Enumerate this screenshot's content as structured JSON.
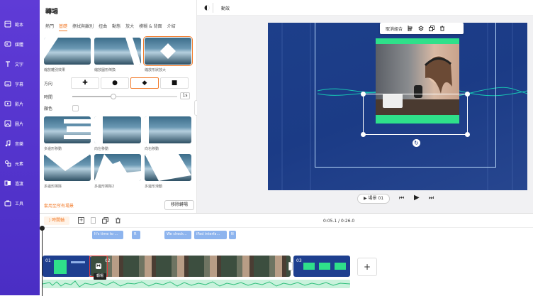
{
  "sidebar": {
    "items": [
      {
        "label": "範本",
        "icon": "template-icon"
      },
      {
        "label": "媒體",
        "icon": "media-icon"
      },
      {
        "label": "文字",
        "icon": "text-icon"
      },
      {
        "label": "字幕",
        "icon": "subtitle-icon"
      },
      {
        "label": "影片",
        "icon": "video-icon"
      },
      {
        "label": "圖片",
        "icon": "image-icon"
      },
      {
        "label": "音樂",
        "icon": "music-icon"
      },
      {
        "label": "元素",
        "icon": "element-icon"
      },
      {
        "label": "過渡",
        "icon": "transition-icon"
      },
      {
        "label": "工具",
        "icon": "tools-icon"
      }
    ]
  },
  "panel": {
    "title": "轉場",
    "tabs": [
      "熱門",
      "基礎",
      "擦拭與離別",
      "扭曲",
      "動態",
      "放大",
      "模糊 & 背面",
      "介紹"
    ],
    "active_tab": 1,
    "thumbs_row1": [
      "縮放離別效果",
      "縮放圖形倒換",
      "縮放形狀放大"
    ],
    "direction_label": "方向",
    "duration_label": "時間",
    "duration_value": "1s",
    "color_label": "顏色",
    "thumbs_row2": [
      "多邊形移動",
      "向左移動",
      "向右移動"
    ],
    "thumbs_row3": [
      "多邊形擦除",
      "多邊形擦除2",
      "多邊形滑動"
    ],
    "apply_all": "套用至所有場景",
    "remove_btn": "移除轉場"
  },
  "toolbar": {
    "label": "動效"
  },
  "overlay": {
    "label": "取消組合"
  },
  "player": {
    "scene_label": "場景 01",
    "time": "0:05.1 / 0:26.0"
  },
  "timeline": {
    "tag": "時間軸",
    "captions": [
      "It's time to ...",
      "R",
      "We check...",
      "iPad interfa...",
      "N"
    ],
    "scene1": "01",
    "scene2": "02",
    "scene3": "03",
    "transition_tag": "轉場",
    "add": "+"
  }
}
